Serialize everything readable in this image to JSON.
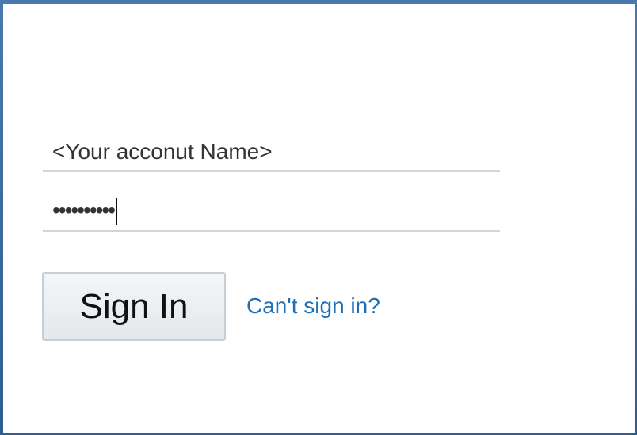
{
  "login": {
    "account_value": "<Your acconut Name>",
    "password_mask": "••••••••••",
    "signin_label": "Sign In",
    "help_link_label": "Can't sign in?"
  },
  "colors": {
    "link": "#1f6fb6",
    "frame": "#2f5d8f"
  }
}
